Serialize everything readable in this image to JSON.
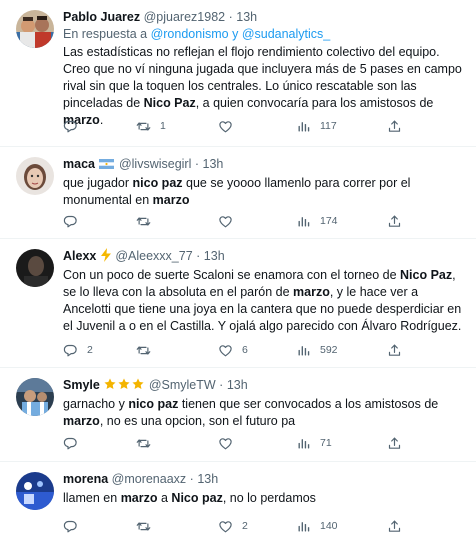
{
  "tweets": [
    {
      "name": "Pablo Juarez",
      "handle": "@pjuarez1982",
      "time": "13h",
      "reply_prefix": "En respuesta a",
      "reply_user1": "@rondonismo",
      "reply_and": "y",
      "reply_user2": "@sudanalytics_",
      "t1": "Las estadísticas no reflejan el flojo rendimiento colectivo del equipo. Creo que no ví ninguna jugada que incluyera más de 5 pases en campo rival sin que la toquen los centrales. Lo único rescatable son las pinceladas de ",
      "b1": "Nico Paz",
      "t2": ", a quien convocaría para los amistosos de ",
      "b2": "marzo",
      "t3": ".",
      "replies": "",
      "retweets": "1",
      "likes": "",
      "views": "117"
    },
    {
      "name": "maca",
      "handle": "@livswisegirl",
      "time": "13h",
      "t1": "que jugador ",
      "b1": "nico paz",
      "t2": " que se yoooo llamenlo para correr por el monumental en ",
      "b2": "marzo",
      "replies": "",
      "retweets": "",
      "likes": "",
      "views": "174"
    },
    {
      "name": "Alexx",
      "handle": "@Aleexxx_77",
      "time": "13h",
      "t1": "Con un poco de suerte Scaloni se enamora con el torneo de ",
      "b1": "Nico Paz",
      "t2": ", se lo lleva con la absoluta en el parón de ",
      "b2": "marzo",
      "t3": ", y le hace ver a Ancelotti que tiene una joya en la cantera que no puede desperdiciar en el Juvenil a o en el Castilla. Y ojalá algo parecido con Álvaro Rodríguez.",
      "replies": "2",
      "retweets": "",
      "likes": "6",
      "views": "592"
    },
    {
      "name": "Smyle",
      "handle": "@SmyleTW",
      "time": "13h",
      "t1": "garnacho y ",
      "b1": "nico paz",
      "t2": " tienen que ser convocados a los amistosos de ",
      "b2": "marzo",
      "t3": ", no es una opcion, son el futuro pa",
      "replies": "",
      "retweets": "",
      "likes": "",
      "views": "71"
    },
    {
      "name": "morena",
      "handle": "@morenaaxz",
      "time": "13h",
      "t1": "llamen en ",
      "b1": "marzo",
      "t2": " a ",
      "b2": "Nico paz",
      "t3": ", no lo perdamos",
      "replies": "",
      "retweets": "",
      "likes": "2",
      "views": "140"
    }
  ],
  "separator": "·",
  "colors": {
    "text": "#0f1419",
    "secondary": "#536471",
    "link": "#1d9bf0",
    "divider": "#eff3f4",
    "star": "#f4b400",
    "bolt": "#f5b800"
  },
  "icons": [
    "reply-icon",
    "retweet-icon",
    "like-icon",
    "views-icon",
    "share-icon",
    "argentina-flag-icon",
    "lightning-icon",
    "star-icon"
  ]
}
